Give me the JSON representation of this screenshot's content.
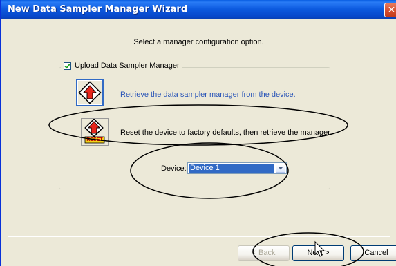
{
  "window": {
    "title": "New Data Sampler Manager Wizard",
    "close_label": "✕"
  },
  "instruction": "Select a manager configuration option.",
  "group": {
    "label": "Upload Data Sampler Manager",
    "checked": true
  },
  "options": [
    {
      "label": "Retrieve the data sampler manager from the device.",
      "icon": "retrieve-up-arrow-icon"
    },
    {
      "label": "Reset the device to factory defaults, then retrieve the manager.",
      "icon": "reset-up-arrow-icon",
      "badge": "RESET"
    }
  ],
  "device": {
    "label": "Device:",
    "value": "Device 1"
  },
  "buttons": {
    "back": "< Back",
    "next": "Next >",
    "cancel": "Cancel"
  },
  "colors": {
    "title_bar": "#0a5fe3",
    "selection": "#316ac5",
    "option_link": "#2a55b8",
    "close": "#d44a2c"
  }
}
